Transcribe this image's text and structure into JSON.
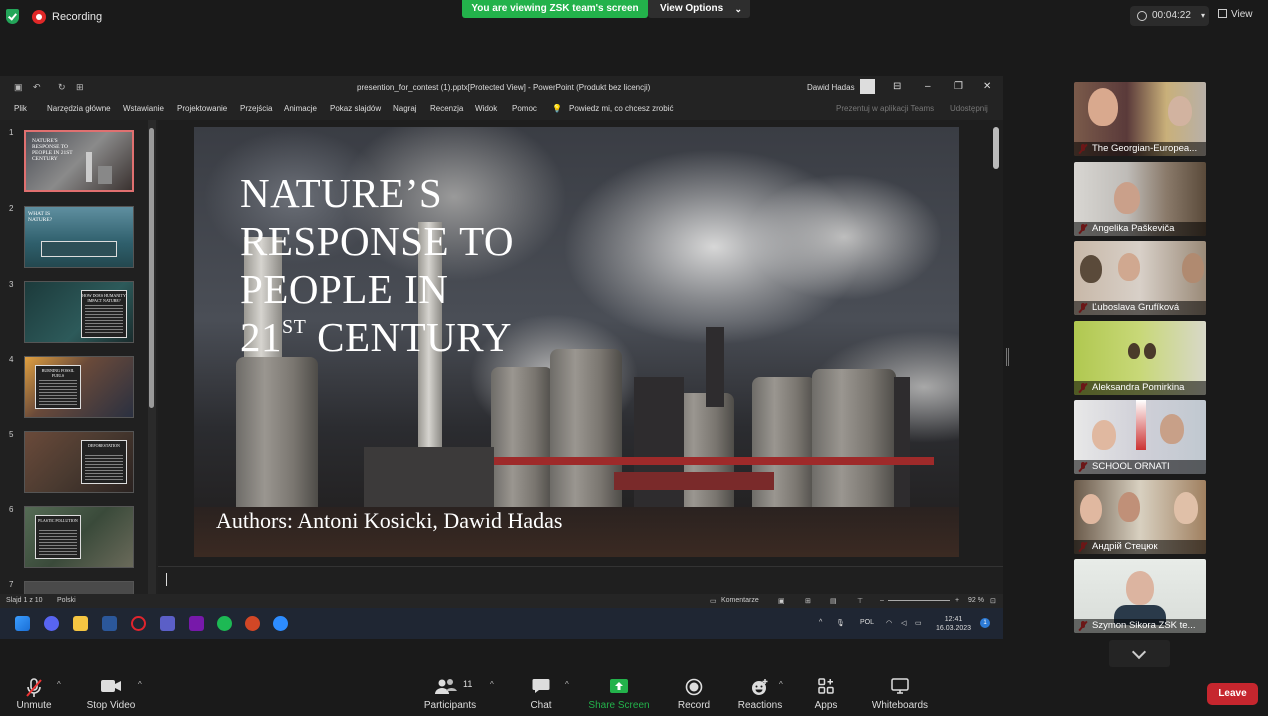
{
  "meeting": {
    "recording_label": "Recording",
    "viewing_banner": "You are viewing ZSK team's screen",
    "view_options": "View Options",
    "timer": "00:04:22",
    "view_label": "View"
  },
  "ppt": {
    "window_title": "presention_for_contest (1).pptx[Protected View] - PowerPoint (Produkt bez licencji)",
    "user": "Dawid Hadas",
    "ribbon": [
      "Plik",
      "Narzędzia główne",
      "Wstawianie",
      "Projektowanie",
      "Przejścia",
      "Animacje",
      "Pokaz slajdów",
      "Nagraj",
      "Recenzja",
      "Widok",
      "Pomoc"
    ],
    "tell_me": "Powiedz mi, co chcesz zrobić",
    "teams_share": "Prezentuj w aplikacji Teams",
    "share": "Udostępnij",
    "thumbs": [
      {
        "num": "1",
        "title": "NATURE'S RESPONSE TO PEOPLE IN 21ST CENTURY"
      },
      {
        "num": "2",
        "title": "WHAT IS NATURE?"
      },
      {
        "num": "3",
        "title": "HOW DOES HUMANITY IMPACT NATURE?"
      },
      {
        "num": "4",
        "title": "BURNING FOSSIL FUELS"
      },
      {
        "num": "5",
        "title": "DEFORESTATION"
      },
      {
        "num": "6",
        "title": "PLASTIC POLLUTION"
      },
      {
        "num": "7",
        "title": ""
      }
    ],
    "slide": {
      "title_l1": "NATURE’S",
      "title_l2": "RESPONSE TO",
      "title_l3": "PEOPLE IN",
      "title_l4_pre": "21",
      "title_l4_sup": "ST",
      "title_l4_post": " CENTURY",
      "authors": "Authors: Antoni Kosicki, Dawid Hadas"
    },
    "status": {
      "slide_count": "Slajd 1 z 10",
      "language": "Polski",
      "comments": "Komentarze",
      "zoom": "92 %"
    },
    "taskbar": {
      "lang": "POL",
      "time": "12:41",
      "date": "16.03.2023",
      "badge": "1"
    }
  },
  "participants_tiles": [
    {
      "name": "The Georgian-Europea..."
    },
    {
      "name": "Angelika Paškeviča"
    },
    {
      "name": "Ľuboslava Grufíková"
    },
    {
      "name": "Aleksandra Pomirkina"
    },
    {
      "name": "SCHOOL ORNATI"
    },
    {
      "name": "Андрій Стецюк"
    },
    {
      "name": "Szymon Sikora ZSK te..."
    }
  ],
  "controls": {
    "unmute": "Unmute",
    "stop_video": "Stop Video",
    "participants": "Participants",
    "participants_count": "11",
    "chat": "Chat",
    "share_screen": "Share Screen",
    "record": "Record",
    "reactions": "Reactions",
    "apps": "Apps",
    "whiteboards": "Whiteboards",
    "leave": "Leave"
  },
  "colors": {
    "banner_green": "#23b24b",
    "leave_red": "#c6262e",
    "share_green": "#23b24b"
  }
}
